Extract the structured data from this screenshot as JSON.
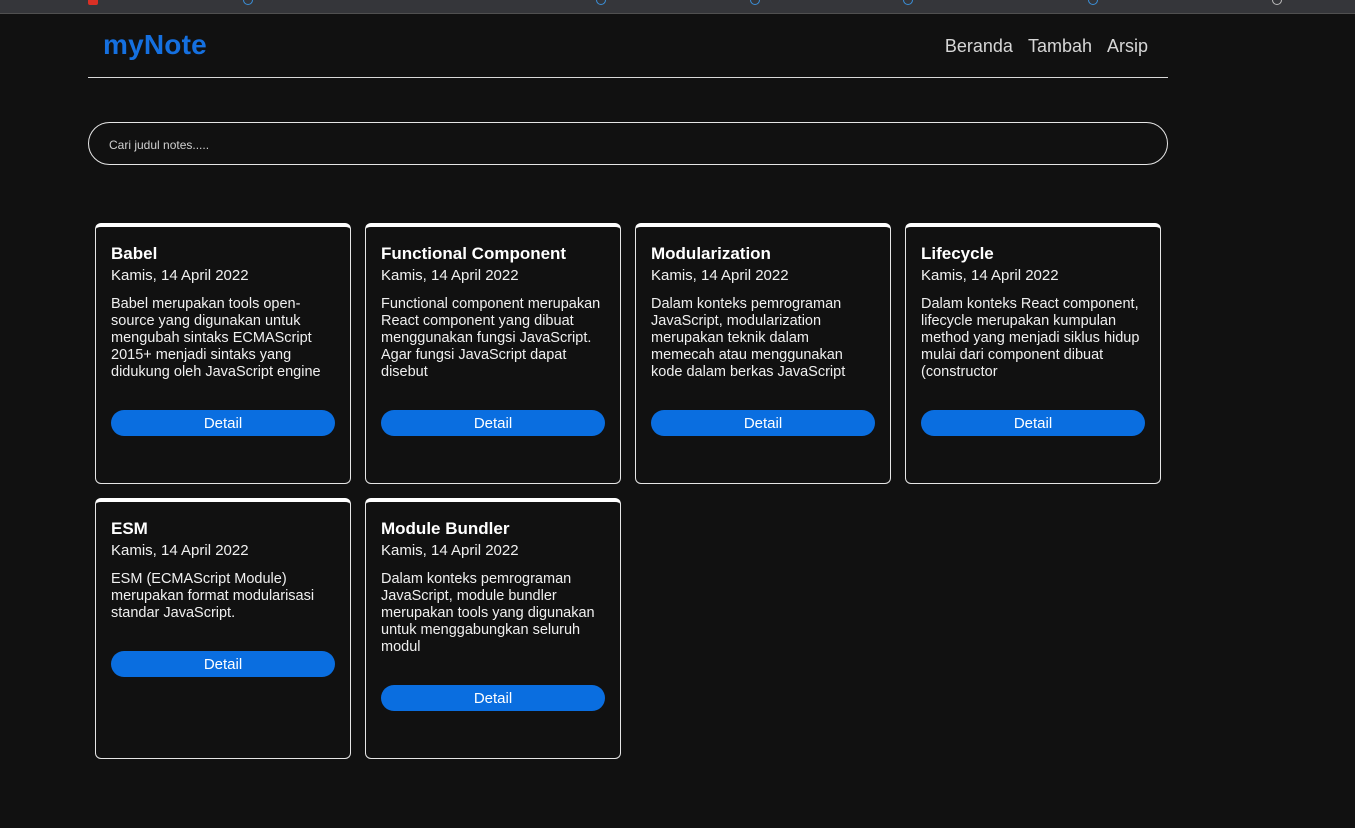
{
  "app": {
    "brand": "myNote",
    "accent_color": "#1570e0",
    "button_color": "#0a6ee0"
  },
  "nav": {
    "items": [
      {
        "label": "Beranda"
      },
      {
        "label": "Tambah"
      },
      {
        "label": "Arsip"
      }
    ]
  },
  "search": {
    "placeholder": "Cari judul notes.....",
    "value": ""
  },
  "notes": [
    {
      "title": "Babel",
      "date": "Kamis, 14 April 2022",
      "body": "Babel merupakan tools open-source yang digunakan untuk mengubah sintaks ECMAScript 2015+ menjadi sintaks yang didukung oleh JavaScript engine",
      "button": "Detail"
    },
    {
      "title": "Functional Component",
      "date": "Kamis, 14 April 2022",
      "body": "Functional component merupakan React component yang dibuat menggunakan fungsi JavaScript. Agar fungsi JavaScript dapat disebut",
      "button": "Detail"
    },
    {
      "title": "Modularization",
      "date": "Kamis, 14 April 2022",
      "body": "Dalam konteks pemrograman JavaScript, modularization merupakan teknik dalam memecah atau menggunakan kode dalam berkas JavaScript",
      "button": "Detail"
    },
    {
      "title": "Lifecycle",
      "date": "Kamis, 14 April 2022",
      "body": "Dalam konteks React component, lifecycle merupakan kumpulan method yang menjadi siklus hidup mulai dari component dibuat (constructor",
      "button": "Detail"
    },
    {
      "title": "ESM",
      "date": "Kamis, 14 April 2022",
      "body": "ESM (ECMAScript Module) merupakan format modularisasi standar JavaScript.",
      "button": "Detail"
    },
    {
      "title": "Module Bundler",
      "date": "Kamis, 14 April 2022",
      "body": "Dalam konteks pemrograman JavaScript, module bundler merupakan tools yang digunakan untuk menggabungkan seluruh modul",
      "button": "Detail"
    }
  ]
}
